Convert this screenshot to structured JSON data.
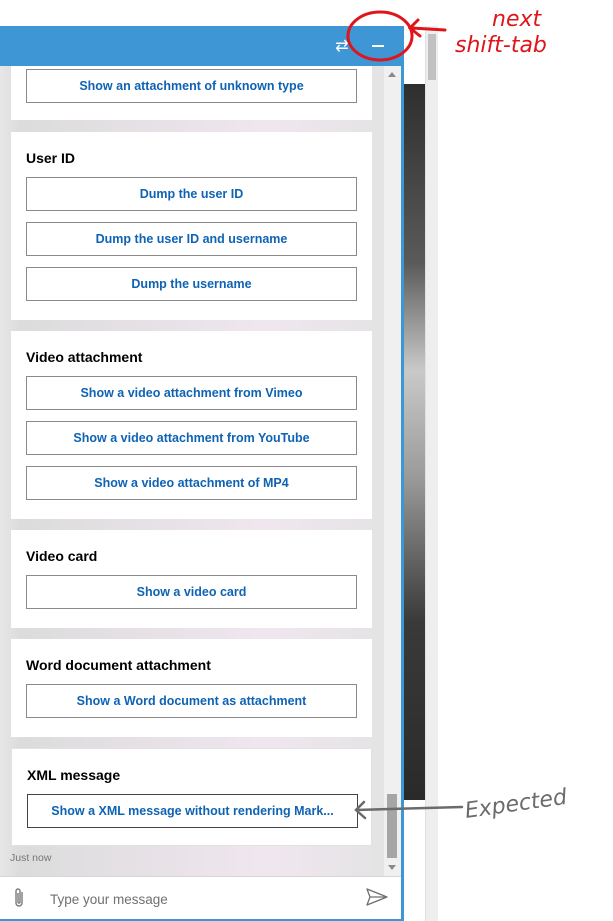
{
  "cards": [
    {
      "title": "",
      "actions": [
        "Show an attachment of unknown type"
      ]
    },
    {
      "title": "User ID",
      "actions": [
        "Dump the user ID",
        "Dump the user ID and username",
        "Dump the username"
      ]
    },
    {
      "title": "Video attachment",
      "actions": [
        "Show a video attachment from Vimeo",
        "Show a video attachment from YouTube",
        "Show a video attachment of MP4"
      ]
    },
    {
      "title": "Video card",
      "actions": [
        "Show a video card"
      ]
    },
    {
      "title": "Word document attachment",
      "actions": [
        "Show a Word document as attachment"
      ]
    },
    {
      "title": "XML message",
      "actions": [
        "Show a XML message without rendering Mark..."
      ]
    }
  ],
  "timestamp": "Just now",
  "sendbox": {
    "placeholder": "Type your message"
  },
  "icons": {
    "switch": "switch-arrows-icon",
    "minimize": "minimize-icon",
    "attach": "paperclip-icon",
    "send": "send-icon"
  },
  "colors": {
    "accent": "#3f96d4",
    "link": "#0e63b4",
    "annotation_red": "#e0151b",
    "annotation_gray": "#6b6b6b"
  },
  "annotations": {
    "top_note_line1": "next",
    "top_note_line2": "shift-tab",
    "side_note": "Expected"
  }
}
